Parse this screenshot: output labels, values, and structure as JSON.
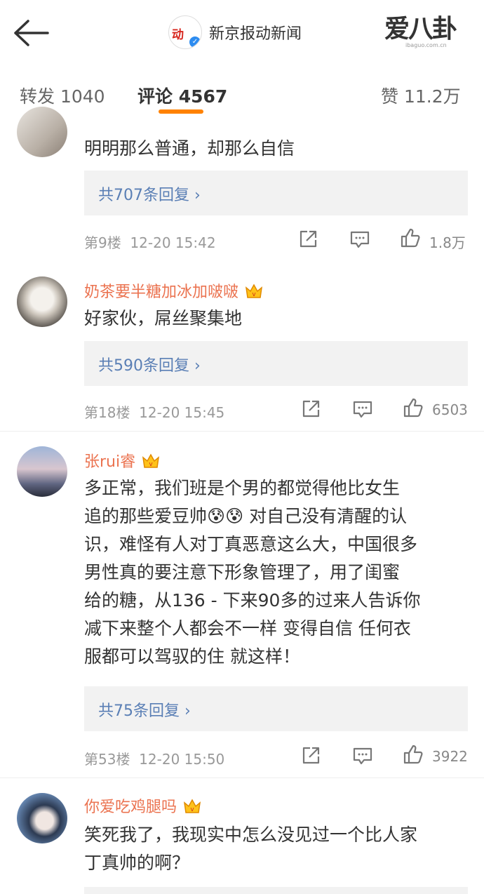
{
  "header": {
    "source_name": "新京报动新闻",
    "source_logo_text": "动",
    "watermark_main": "爱八卦",
    "watermark_sub": "ibaguo.com.cn"
  },
  "tabs": {
    "repost_label": "转发 1040",
    "comment_label": "评论 4567",
    "like_label": "赞 11.2万"
  },
  "comments": [
    {
      "username": "",
      "text": "明明那么普通，却那么自信",
      "replies": "共707条回复",
      "floor": "第9楼",
      "time": "12-20 15:42",
      "likes": "1.8万"
    },
    {
      "username": "奶茶要半糖加冰加啵啵",
      "text": "好家伙，屌丝聚集地",
      "replies": "共590条回复",
      "floor": "第18楼",
      "time": "12-20 15:45",
      "likes": "6503"
    },
    {
      "username": "张rui睿",
      "text_lines": [
        "多正常，我们班是个男的都觉得他比女生",
        "追的那些爱豆帅😰😰 对自己没有清醒的认",
        "识，难怪有人对丁真恶意这么大，中国很多",
        "男性真的要注意下形象管理了，用了闺蜜",
        "给的糖，从136 - 下来90多的过来人告诉你",
        "减下来整个人都会不一样 变得自信 任何衣",
        "服都可以驾驭的住 就这样！"
      ],
      "replies": "共75条回复",
      "floor": "第53楼",
      "time": "12-20 15:50",
      "likes": "3922"
    },
    {
      "username": "你爱吃鸡腿吗",
      "text_lines": [
        "笑死我了，我现实中怎么没见过一个比人家",
        "丁真帅的啊？"
      ]
    }
  ],
  "icons": [
    "back-arrow-icon",
    "verified-badge-icon",
    "vip-crown-icon",
    "repost-icon",
    "comment-icon",
    "like-icon",
    "chevron-right-icon"
  ],
  "colors": {
    "accent": "#ff8200",
    "username": "#eb7350",
    "reply_link": "#5a7fb5",
    "meta": "#999999"
  }
}
